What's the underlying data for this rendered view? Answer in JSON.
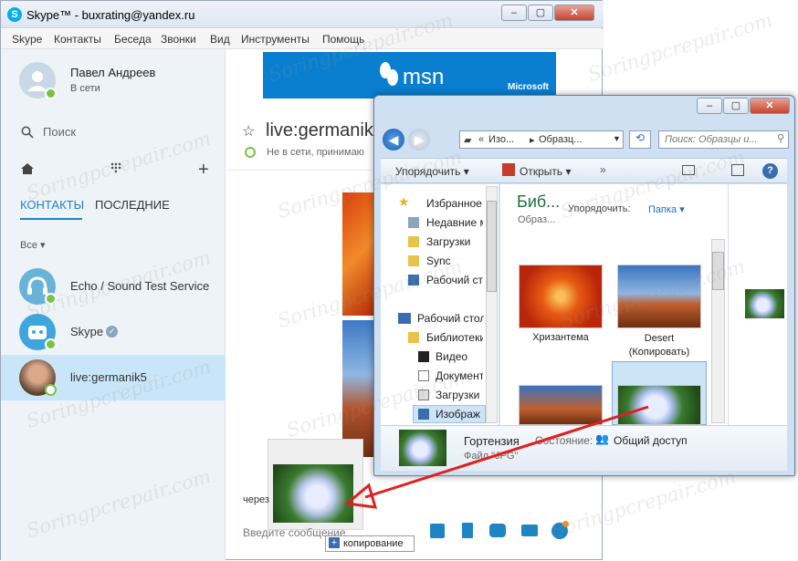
{
  "skype": {
    "title": "Skype™ - buxrating@yandex.ru",
    "menu": [
      "Skype",
      "Контакты",
      "Беседа",
      "Звонки",
      "Вид",
      "Инструменты",
      "Помощь"
    ],
    "profile": {
      "name": "Павел Андреев",
      "status": "В сети"
    },
    "search_placeholder": "Поиск",
    "tabs": [
      "КОНТАКТЫ",
      "ПОСЛЕДНИЕ"
    ],
    "filter": "Все",
    "contacts": [
      {
        "name": "Echo / Sound Test Service"
      },
      {
        "name": "Skype"
      },
      {
        "name": "live:germanik5"
      }
    ],
    "banner": {
      "brand": "msn",
      "vendor": "Microsoft"
    },
    "chat": {
      "title": "live:germanik5",
      "status": "Не в сети, принимаю",
      "via": "через",
      "input_placeholder": "Введите сообщение"
    },
    "copy_tooltip": "копирование"
  },
  "explorer": {
    "breadcrumb": [
      "Изо...",
      "Образц..."
    ],
    "search_placeholder": "Поиск: Образцы и...",
    "toolbar": {
      "organize": "Упорядочить",
      "open": "Открыть"
    },
    "nav": {
      "favorites": "Избранное",
      "fav_items": [
        "Недавние м",
        "Загрузки",
        "Sync",
        "Рабочий ст"
      ],
      "desktop": "Рабочий стол",
      "libraries": "Библиотеки",
      "lib_items": [
        "Видео",
        "Документ",
        "Загрузки",
        "Изображ"
      ]
    },
    "library_title": "Биб...",
    "library_sub": "Образ...",
    "arrange_label": "Упорядочить:",
    "arrange_value": "Папка",
    "files": [
      {
        "name": "Хризантема"
      },
      {
        "name": "Desert (Копировать)"
      }
    ],
    "details": {
      "name": "Гортензия",
      "status_label": "Состояние:",
      "status_value": "Общий доступ",
      "type": "Файл \"JPG\""
    }
  },
  "watermark": "Soringpcrepair.com",
  "colors": {
    "skype_blue": "#00aff0",
    "accent": "#1e84c4",
    "online": "#7cc242",
    "arrow": "#e02020"
  }
}
